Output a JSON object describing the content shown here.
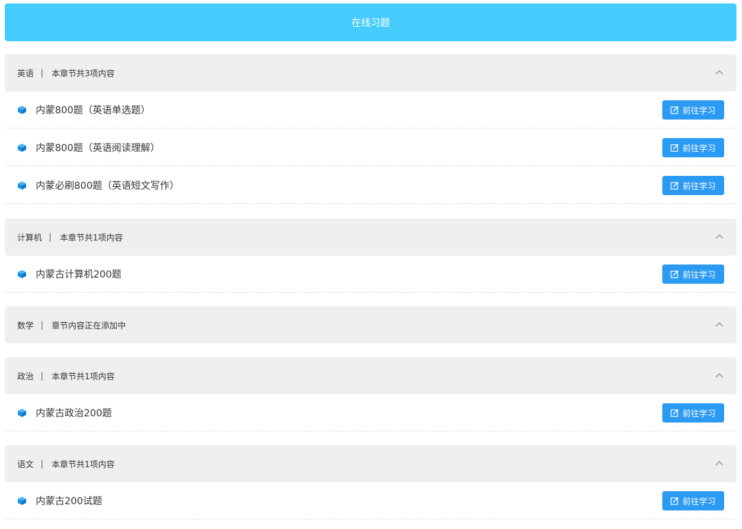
{
  "header": {
    "title": "在线习题"
  },
  "colors": {
    "title_bar": "#45ccfd",
    "button": "#2b9af3",
    "cube": "#1a8fe6",
    "section_bg": "#efefef"
  },
  "sections": [
    {
      "name": "英语",
      "separator": "|",
      "summary": "本章节共3项内容",
      "items": [
        {
          "title": "内蒙800题（英语单选题）",
          "button": "前往学习"
        },
        {
          "title": "内蒙800题（英语阅读理解）",
          "button": "前往学习"
        },
        {
          "title": "内蒙必刷800题（英语短文写作）",
          "button": "前往学习"
        }
      ]
    },
    {
      "name": "计算机",
      "separator": "|",
      "summary": "本章节共1项内容",
      "items": [
        {
          "title": "内蒙古计算机200题",
          "button": "前往学习"
        }
      ]
    },
    {
      "name": "数学",
      "separator": "|",
      "summary": "章节内容正在添加中",
      "items": []
    },
    {
      "name": "政治",
      "separator": "|",
      "summary": "本章节共1项内容",
      "items": [
        {
          "title": "内蒙古政治200题",
          "button": "前往学习"
        }
      ]
    },
    {
      "name": "语文",
      "separator": "|",
      "summary": "本章节共1项内容",
      "items": [
        {
          "title": "内蒙古200试题",
          "button": "前往学习"
        }
      ]
    }
  ]
}
